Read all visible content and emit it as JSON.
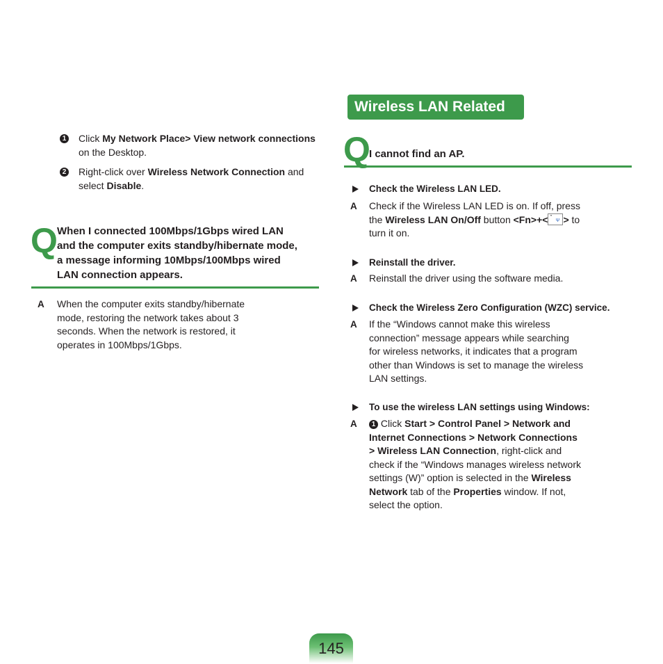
{
  "left_column": {
    "steps": [
      {
        "num": "1",
        "parts": [
          {
            "t": "Click ",
            "b": false
          },
          {
            "t": "My Network Place> View network connections",
            "b": true
          },
          {
            "t": " on the Desktop.",
            "b": false
          }
        ]
      },
      {
        "num": "2",
        "parts": [
          {
            "t": "Right-click over ",
            "b": false
          },
          {
            "t": "Wireless Network Connection",
            "b": true
          },
          {
            "t": " and select ",
            "b": false
          },
          {
            "t": "Disable",
            "b": true
          },
          {
            "t": ".",
            "b": false
          }
        ]
      }
    ],
    "question": {
      "q_mark": "Q",
      "lines": [
        "When I connected 100Mbps/1Gbps wired LAN",
        "and the computer exits standby/hibernate mode,",
        "a message informing 10Mbps/100Mbps wired",
        "LAN connection appears."
      ]
    },
    "answer": {
      "label": "A",
      "lines": [
        "When the computer exits standby/hibernate",
        "mode, restoring the network takes about 3",
        "seconds. When the network is restored, it",
        "operates in 100Mbps/1Gbps."
      ]
    }
  },
  "right_column": {
    "section_title": "Wireless LAN Related",
    "question": {
      "q_mark": "Q",
      "text": "I cannot find an AP."
    },
    "items": [
      {
        "heading": "Check the Wireless LAN LED.",
        "answer_label": "A",
        "answer_lines": [
          [
            {
              "t": "Check if the Wireless LAN LED is on. If off, press",
              "b": false
            }
          ],
          [
            {
              "t": "the ",
              "b": false
            },
            {
              "t": "Wireless LAN On/Off",
              "b": true
            },
            {
              "t": " button ",
              "b": false
            },
            {
              "t": "<Fn>+<",
              "b": true
            },
            {
              "t": "__KEY__",
              "b": false
            },
            {
              "t": ">",
              "b": true
            },
            {
              "t": " to",
              "b": false
            }
          ],
          [
            {
              "t": "turn it on.",
              "b": false
            }
          ]
        ]
      },
      {
        "heading": "Reinstall the driver.",
        "answer_label": "A",
        "answer_lines": [
          [
            {
              "t": "Reinstall the driver using the software media.",
              "b": false
            }
          ]
        ]
      },
      {
        "heading": "Check the Wireless Zero Configuration (WZC) service.",
        "answer_label": "A",
        "answer_lines": [
          [
            {
              "t": "If the “Windows cannot make this wireless",
              "b": false
            }
          ],
          [
            {
              "t": "connection” message appears while searching",
              "b": false
            }
          ],
          [
            {
              "t": "for wireless networks, it indicates that a program",
              "b": false
            }
          ],
          [
            {
              "t": "other than Windows is set to manage the wireless",
              "b": false
            }
          ],
          [
            {
              "t": "LAN settings.",
              "b": false
            }
          ]
        ]
      },
      {
        "heading": "To use the wireless LAN settings using Windows:",
        "answer_label": "A",
        "step_num": "1",
        "answer_lines": [
          [
            {
              "t": " Click ",
              "b": false
            },
            {
              "t": "Start > Control Panel > Network and",
              "b": true
            }
          ],
          [
            {
              "t": "Internet Connections > Network Connections",
              "b": true
            }
          ],
          [
            {
              "t": "> Wireless LAN Connection",
              "b": true
            },
            {
              "t": ", right-click and",
              "b": false
            }
          ],
          [
            {
              "t": "check if the “Windows manages wireless network",
              "b": false
            }
          ],
          [
            {
              "t": "settings (W)” option is selected in the ",
              "b": false
            },
            {
              "t": "Wireless",
              "b": true
            }
          ],
          [
            {
              "t": "Network",
              "b": true
            },
            {
              "t": " tab of the ",
              "b": false
            },
            {
              "t": "Properties",
              "b": true
            },
            {
              "t": " window. If not,",
              "b": false
            }
          ],
          [
            {
              "t": "select the option.",
              "b": false
            }
          ]
        ]
      }
    ],
    "key_icon": {
      "name": "wireless-key-icon",
      "top_glyph": "”",
      "bottom_glyph": "Ψ"
    }
  },
  "footer": {
    "page_number": "145"
  },
  "colors": {
    "accent_green": "#3d9a4b",
    "text": "#231f20"
  }
}
